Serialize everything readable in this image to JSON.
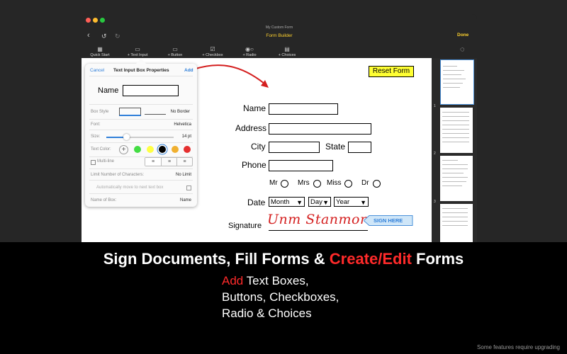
{
  "window": {
    "subtitle": "My Custom Form",
    "title": "Form Builder",
    "done_label": "Done"
  },
  "toolbar": {
    "items": [
      {
        "label": "Quick Start",
        "icon": "quick-start-icon"
      },
      {
        "label": "+ Text Input",
        "icon": "text-input-icon"
      },
      {
        "label": "+ Button",
        "icon": "button-icon"
      },
      {
        "label": "+ Checkbox",
        "icon": "checkbox-icon"
      },
      {
        "label": "+ Radio",
        "icon": "radio-icon"
      },
      {
        "label": "+ Choices",
        "icon": "choices-icon"
      }
    ]
  },
  "popover": {
    "cancel": "Cancel",
    "title": "Text Input Box Properties",
    "add": "Add",
    "preview_label": "Name",
    "box_style_label": "Box Style",
    "no_border": "No Border",
    "font_label": "Font:",
    "font_value": "Helvetica",
    "size_label": "Size:",
    "size_value": "14 pt",
    "text_color_label": "Text Color:",
    "colors": [
      "#44dd44",
      "#ffff44",
      "#000000",
      "#f0b030",
      "#e53030"
    ],
    "multiline_label": "Multi-line",
    "limit_label": "Limit Number of Characters:",
    "limit_value": "No Limit",
    "auto_move_label": "Automatically move to next text box",
    "name_label": "Name of Box:",
    "name_value": "Name"
  },
  "form": {
    "reset_label": "Reset Form",
    "name_label": "Name",
    "address_label": "Address",
    "city_label": "City",
    "state_label": "State",
    "phone_label": "Phone",
    "titles": [
      "Mr",
      "Mrs",
      "Miss",
      "Dr"
    ],
    "date_label": "Date",
    "month": "Month",
    "day": "Day",
    "year": "Year",
    "signature_label": "Signature",
    "signature_text": "Unm Stanmore",
    "sign_here": "SIGN HERE"
  },
  "thumbnails": {
    "page_numbers": [
      "1",
      "2",
      "3"
    ]
  },
  "marketing": {
    "heading_part1": "Sign Documents, Fill Forms & ",
    "heading_part2": "Create/Edit",
    "heading_part3": " Forms",
    "line1_red": "Add",
    "line1_rest": " Text Boxes,",
    "line2": "Buttons, Checkboxes,",
    "line3": "Radio & Choices",
    "footer": "Some features require upgrading"
  },
  "colors": {
    "accent_blue": "#2f7fd9",
    "done_yellow": "#ffd22e",
    "brand_red": "#ff2a2a",
    "signature_red": "#d41f1f"
  }
}
